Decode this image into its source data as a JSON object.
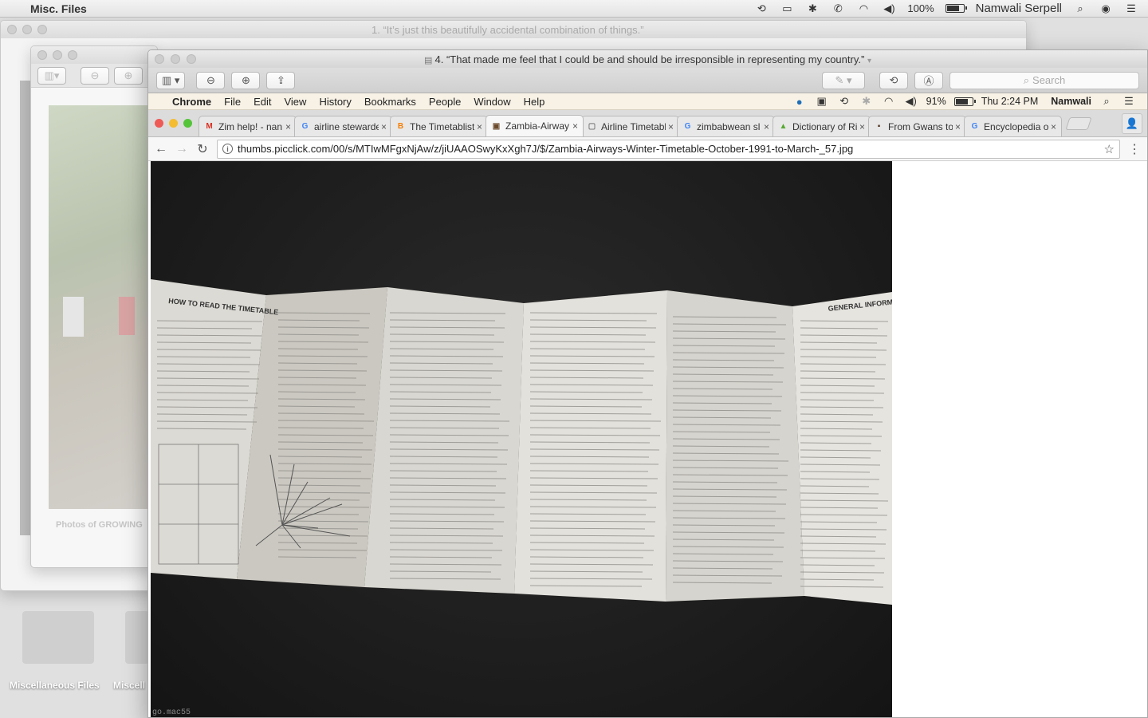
{
  "os_menubar": {
    "app_name": "Misc. Files",
    "user_name": "Namwali Serpell",
    "battery_text": "100%"
  },
  "desktop": {
    "folders": [
      {
        "label": "Miscellaneous Files"
      },
      {
        "label": "Miscell"
      }
    ]
  },
  "bg_windows": {
    "back_title": "1. “It’s just this beautifully accidental combination of things.”",
    "middle_caption": "Photos of GROWING"
  },
  "preview": {
    "title": "4. “That made me feel that I could be and should be irresponsible in representing my country.”",
    "search_placeholder": "Search"
  },
  "inner_menubar": {
    "app": "Chrome",
    "items": [
      "File",
      "Edit",
      "View",
      "History",
      "Bookmarks",
      "People",
      "Window",
      "Help"
    ],
    "battery": "91%",
    "clock": "Thu 2:24 PM",
    "user": "Namwali"
  },
  "tabs": [
    {
      "label": "Zim help! - nan",
      "favicon": "M",
      "favicon_color": "#d93025"
    },
    {
      "label": "airline stewarde",
      "favicon": "G",
      "favicon_color": "#4285f4"
    },
    {
      "label": "The Timetablist",
      "favicon": "B",
      "favicon_color": "#f57d00"
    },
    {
      "label": "Zambia-Airway",
      "favicon": "▣",
      "favicon_color": "#6b4a2b"
    },
    {
      "label": "Airline Timetabl",
      "favicon": "▢",
      "favicon_color": "#777777"
    },
    {
      "label": "zimbabwean sl",
      "favicon": "G",
      "favicon_color": "#4285f4"
    },
    {
      "label": "Dictionary of Ri",
      "favicon": "▲",
      "favicon_color": "#58a832"
    },
    {
      "label": "From Gwans to",
      "favicon": "▪",
      "favicon_color": "#5a3e2b"
    },
    {
      "label": "Encyclopedia o",
      "favicon": "G",
      "favicon_color": "#4285f4"
    }
  ],
  "active_tab_index": 3,
  "address": {
    "url": "thumbs.picclick.com/00/s/MTIwMFgxNjAw/z/jiUAAOSwyKxXgh7J/$/Zambia-Airways-Winter-Timetable-October-1991-to-March-_57.jpg"
  },
  "photo": {
    "caption": "go.mac55",
    "timetable_title": "HOW TO READ THE TIMETABLE",
    "general_info_title": "GENERAL INFORMATION"
  },
  "colors": {
    "chrome_close": "#ee5a55",
    "chrome_minimize": "#f4bd31",
    "chrome_zoom": "#56c43b"
  }
}
